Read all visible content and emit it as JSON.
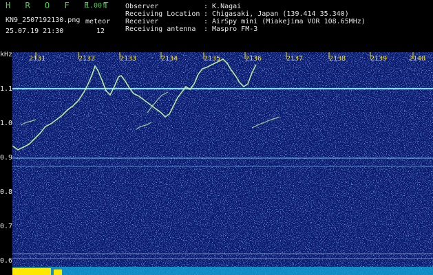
{
  "header": {
    "brand": "H R O F F T",
    "version": "1.00f",
    "filename": "KN9_2507192130.png",
    "meteor_label": "meteor",
    "meteor_count": "12",
    "datetime": "25.07.19 21:30",
    "info": [
      {
        "label": "Observer",
        "value": ": K.Nagai"
      },
      {
        "label": "Receiving Location",
        "value": ": Chigasaki, Japan (139.414 35.340)"
      },
      {
        "label": "Receiver",
        "value": ": AirSpy mini (Miakejima VOR 108.65MHz)"
      },
      {
        "label": "Receiving antenna",
        "value": ": Maspro FM-3"
      }
    ]
  },
  "spectrogram": {
    "y_unit": "kHz",
    "y_ticks": [
      "1.1",
      "1.0",
      "0.9",
      "0.8",
      "0.7",
      "0.6"
    ],
    "x_ticks": [
      "2131",
      "2132",
      "2133",
      "2134",
      "2135",
      "2136",
      "2137",
      "2138",
      "2139",
      "2140"
    ],
    "colors": {
      "background": "#0a1a6e",
      "trace": "#c8ffa0",
      "tick": "#ffe400",
      "level": "#ffe800"
    }
  }
}
